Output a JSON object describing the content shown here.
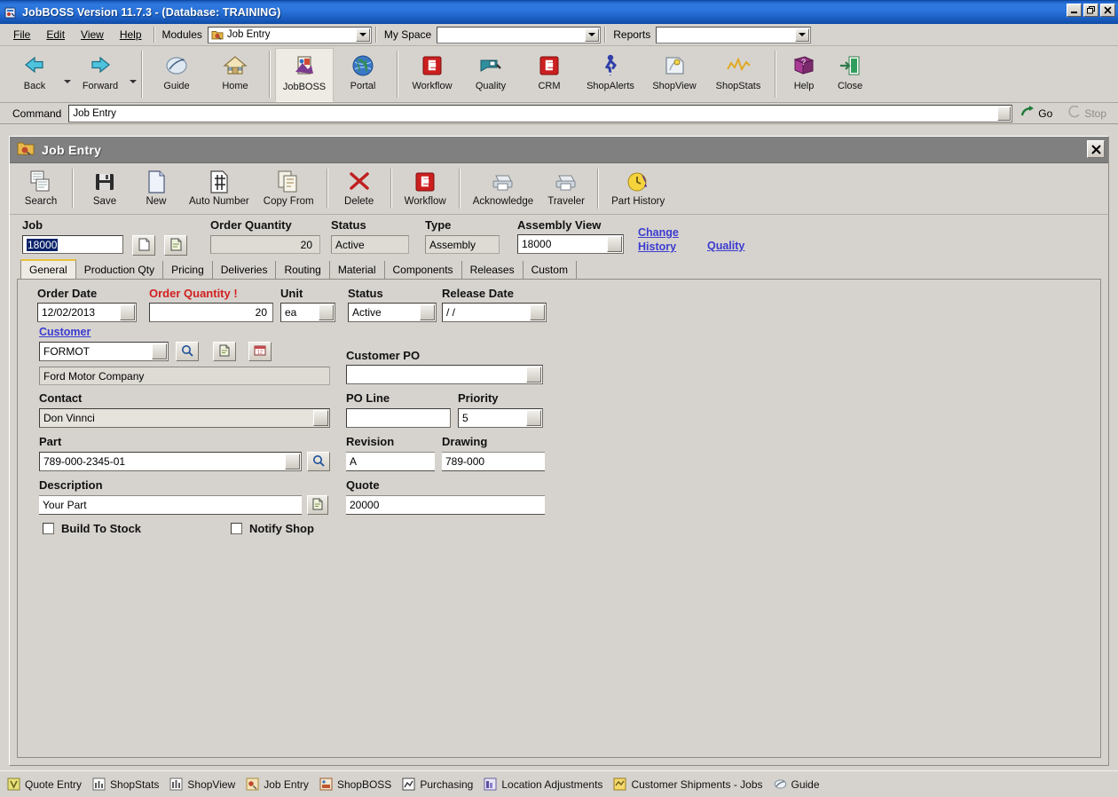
{
  "window": {
    "title": "JobBOSS Version 11.7.3 - (Database: TRAINING)",
    "icon": "jobboss-app-icon",
    "minimize": "_",
    "restore": "❐",
    "close": "✕"
  },
  "menubar": {
    "items": [
      {
        "label": "File",
        "accel": "F"
      },
      {
        "label": "Edit",
        "accel": "E"
      },
      {
        "label": "View",
        "accel": "V"
      },
      {
        "label": "Help",
        "accel": "H"
      }
    ],
    "modules_label": "Modules",
    "modules_value": "Job Entry",
    "myspace_label": "My Space",
    "myspace_value": "",
    "reports_label": "Reports",
    "reports_value": ""
  },
  "toolbar": {
    "buttons": [
      {
        "label": "Back",
        "icon": "back-arrow-icon",
        "dropdown": true,
        "selected": false
      },
      {
        "label": "Forward",
        "icon": "forward-arrow-icon",
        "dropdown": true,
        "selected": false
      },
      {
        "label": "Guide",
        "icon": "guide-icon",
        "dropdown": false,
        "selected": false
      },
      {
        "label": "Home",
        "icon": "home-icon",
        "dropdown": false,
        "selected": false
      },
      {
        "label": "JobBOSS",
        "icon": "jobboss-icon",
        "dropdown": false,
        "selected": true
      },
      {
        "label": "Portal",
        "icon": "globe-icon",
        "dropdown": false,
        "selected": false
      },
      {
        "label": "Workflow",
        "icon": "workflow-e-icon",
        "dropdown": false,
        "selected": false
      },
      {
        "label": "Quality",
        "icon": "quality-icon",
        "dropdown": false,
        "selected": false
      },
      {
        "label": "CRM",
        "icon": "crm-e-icon",
        "dropdown": false,
        "selected": false
      },
      {
        "label": "ShopAlerts",
        "icon": "person-walking-icon",
        "dropdown": false,
        "selected": false
      },
      {
        "label": "ShopView",
        "icon": "shopview-icon",
        "dropdown": false,
        "selected": false
      },
      {
        "label": "ShopStats",
        "icon": "shopstats-chart-icon",
        "dropdown": false,
        "selected": false
      },
      {
        "label": "Help",
        "icon": "help-book-icon",
        "dropdown": false,
        "selected": false
      },
      {
        "label": "Close",
        "icon": "exit-door-icon",
        "dropdown": false,
        "selected": false
      }
    ]
  },
  "commandbar": {
    "label": "Command",
    "value": "Job Entry",
    "go_label": "Go",
    "go_icon": "go-arrow-icon",
    "stop_label": "Stop",
    "stop_icon": "stop-icon"
  },
  "form_window": {
    "title": "Job Entry",
    "icon": "job-entry-folder-icon",
    "close_label": "✕"
  },
  "form_toolbar": {
    "buttons": [
      {
        "label": "Search",
        "icon": "search-pages-icon"
      },
      {
        "label": "Save",
        "icon": "floppy-save-icon"
      },
      {
        "label": "New",
        "icon": "new-page-icon"
      },
      {
        "label": "Auto Number",
        "icon": "auto-number-hash-icon"
      },
      {
        "label": "Copy From",
        "icon": "copy-from-icon"
      },
      {
        "label": "Delete",
        "icon": "delete-x-icon"
      },
      {
        "label": "Workflow",
        "icon": "workflow-e-icon"
      },
      {
        "label": "Acknowledge",
        "icon": "printer-acknowledge-icon"
      },
      {
        "label": "Traveler",
        "icon": "printer-traveler-icon"
      },
      {
        "label": "Part History",
        "icon": "part-history-clock-icon"
      }
    ]
  },
  "header_fields": {
    "job_label": "Job",
    "job_value": "18000",
    "job_btn_1_icon": "new-document-icon",
    "job_btn_2_icon": "copy-document-icon",
    "order_quantity_label": "Order Quantity",
    "order_quantity_value": "20",
    "status_label": "Status",
    "status_value": "Active",
    "type_label": "Type",
    "type_value": "Assembly",
    "assembly_view_label": "Assembly View",
    "assembly_view_value": "18000",
    "change_history_line1": "Change",
    "change_history_line2": "History",
    "quality_link": "Quality"
  },
  "tabs": [
    {
      "label": "General",
      "active": true
    },
    {
      "label": "Production Qty",
      "active": false
    },
    {
      "label": "Pricing",
      "active": false
    },
    {
      "label": "Deliveries",
      "active": false
    },
    {
      "label": "Routing",
      "active": false
    },
    {
      "label": "Material",
      "active": false
    },
    {
      "label": "Components",
      "active": false
    },
    {
      "label": "Releases",
      "active": false
    },
    {
      "label": "Custom",
      "active": false
    }
  ],
  "general_tab": {
    "order_date_label": "Order Date",
    "order_date_value": "12/02/2013",
    "order_quantity_label": "Order Quantity !",
    "order_quantity_value": "20",
    "unit_label": "Unit",
    "unit_value": "ea",
    "status_label": "Status",
    "status_value": "Active",
    "release_date_label": "Release Date",
    "release_date_value": "/  /",
    "customer_label": "Customer",
    "customer_value": "FORMOT",
    "customer_search_icon": "magnifier-icon",
    "customer_doc_icon": "document-icon",
    "customer_calendar_icon": "calendar-icon",
    "customer_name_value": "Ford Motor Company",
    "customer_po_label": "Customer PO",
    "customer_po_value": "",
    "contact_label": "Contact",
    "contact_value": "Don Vinnci",
    "po_line_label": "PO Line",
    "po_line_value": "",
    "priority_label": "Priority",
    "priority_value": "5",
    "part_label": "Part",
    "part_value": "789-000-2345-01",
    "part_search_icon": "magnifier-icon",
    "revision_label": "Revision",
    "revision_value": "A",
    "drawing_label": "Drawing",
    "drawing_value": "789-000",
    "description_label": "Description",
    "description_value": "Your Part",
    "description_doc_icon": "document-icon",
    "quote_label": "Quote",
    "quote_value": "20000",
    "build_to_stock_label": "Build To Stock",
    "build_to_stock_checked": false,
    "notify_shop_label": "Notify Shop",
    "notify_shop_checked": false
  },
  "taskbar": {
    "items": [
      {
        "label": "Quote Entry",
        "icon": "quote-entry-icon"
      },
      {
        "label": "ShopStats",
        "icon": "shopstats-icon"
      },
      {
        "label": "ShopView",
        "icon": "shopview-icon"
      },
      {
        "label": "Job Entry",
        "icon": "job-entry-icon"
      },
      {
        "label": "ShopBOSS",
        "icon": "shopboss-icon"
      },
      {
        "label": "Purchasing",
        "icon": "purchasing-icon"
      },
      {
        "label": "Location Adjustments",
        "icon": "location-adjustments-icon"
      },
      {
        "label": "Customer Shipments - Jobs",
        "icon": "customer-shipments-icon"
      },
      {
        "label": "Guide",
        "icon": "guide-icon"
      }
    ]
  },
  "colors": {
    "title_blue": "#2a74dc",
    "chrome_gray": "#d6d3ce",
    "panel_gray": "#808080",
    "required_red": "#d32020",
    "link_blue": "#3b3bd0",
    "selection_blue": "#0a246a"
  }
}
